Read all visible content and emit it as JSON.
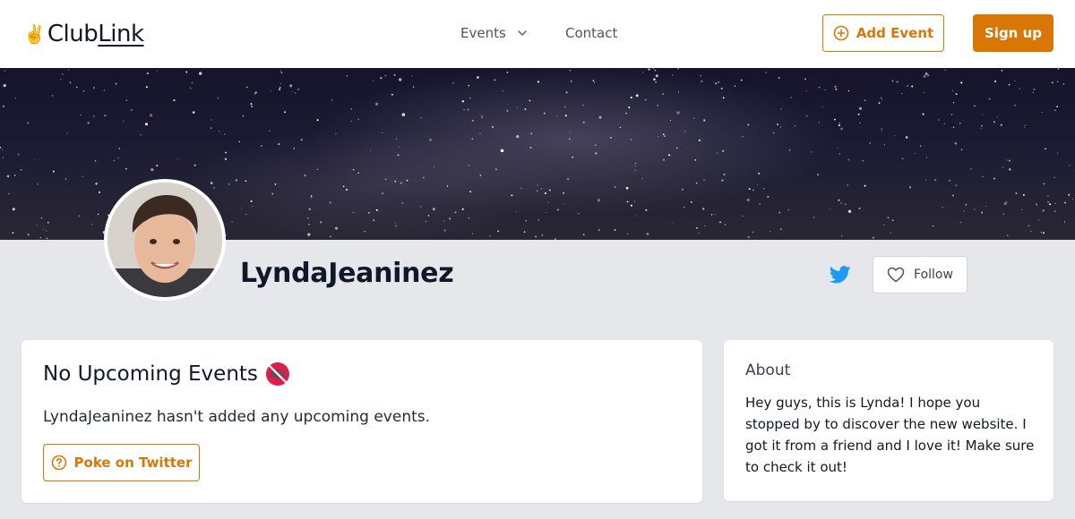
{
  "header": {
    "logo": {
      "emoji": "✌️",
      "part1": "Club",
      "part2": "Link"
    },
    "nav": {
      "events_label": "Events",
      "contact_label": "Contact"
    },
    "add_event_label": "Add Event",
    "signup_label": "Sign up"
  },
  "profile": {
    "name": "LyndaJeaninez",
    "follow_label": "Follow"
  },
  "events_card": {
    "title": "No Upcoming Events",
    "title_emoji": "🔇",
    "description": "LyndaJeaninez hasn't added any upcoming events.",
    "poke_label": "Poke on Twitter"
  },
  "about_card": {
    "title": "About",
    "text": "Hey guys, this is Lynda! I hope you stopped by to discover the new website. I got it from a friend and I love it! Make sure to check it out!"
  },
  "icons": {
    "add_event": "plus-circle-icon",
    "events_dropdown": "chevron-down-icon",
    "twitter": "twitter-icon",
    "follow": "heart-icon",
    "poke": "question-circle-icon"
  },
  "colors": {
    "accent": "#d97706",
    "page_bg": "#e5e7eb",
    "twitter_blue": "#1d9bf0"
  }
}
